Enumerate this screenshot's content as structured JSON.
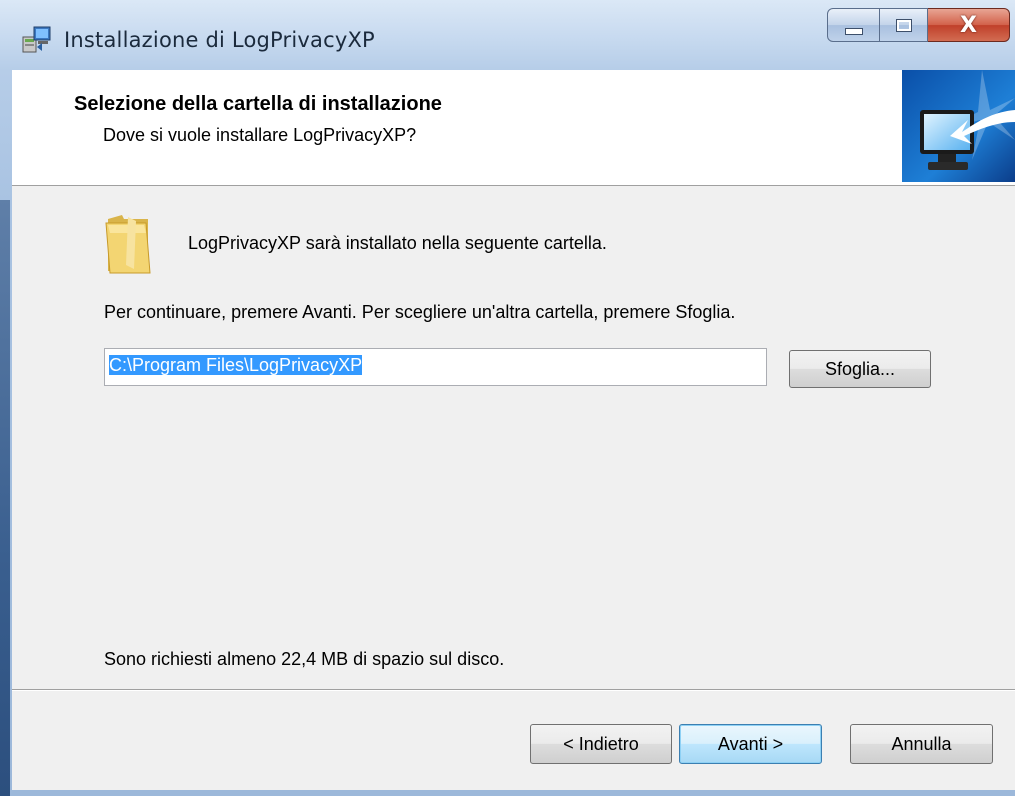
{
  "window": {
    "title": "Installazione di LogPrivacyXP",
    "close_glyph": "X"
  },
  "header": {
    "title": "Selezione della cartella di installazione",
    "subtitle": "Dove si vuole installare LogPrivacyXP?"
  },
  "body": {
    "install_message": "LogPrivacyXP sarà installato nella seguente cartella.",
    "continue_message": "Per continuare, premere Avanti. Per scegliere un'altra cartella, premere Sfoglia.",
    "path_value": "C:\\Program Files\\LogPrivacyXP",
    "browse_label": "Sfoglia...",
    "space_message": "Sono richiesti almeno 22,4 MB di spazio sul disco."
  },
  "footer": {
    "back_label": "< Indietro",
    "next_label": "Avanti >",
    "cancel_label": "Annulla"
  },
  "icons": {
    "app": "setup-icon",
    "folder": "folder-icon",
    "wizard": "computer-install-icon"
  },
  "colors": {
    "selection": "#3399ff",
    "close_button": "#c0402a",
    "client_bg": "#f0f0f0"
  }
}
